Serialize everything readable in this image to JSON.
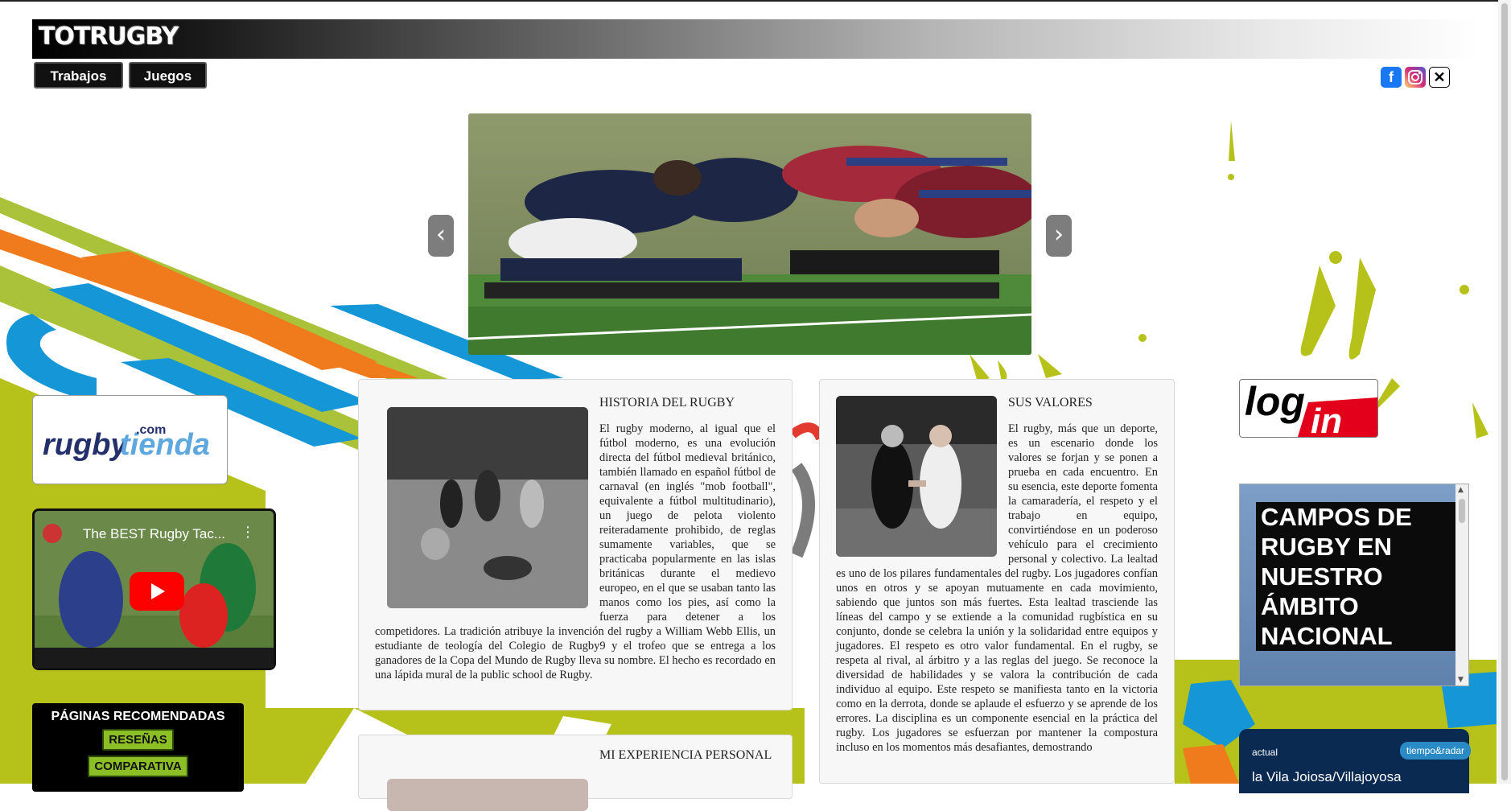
{
  "brand": {
    "logo_text": "TOTRUGBY"
  },
  "nav": [
    {
      "label": "Trabajos"
    },
    {
      "label": "Juegos"
    }
  ],
  "social": [
    {
      "icon": "facebook-icon",
      "color": "#1877f2"
    },
    {
      "icon": "instagram-icon",
      "color": "#d62976"
    },
    {
      "icon": "x-icon",
      "color": "#000000"
    }
  ],
  "carousel": {
    "prev": "‹",
    "next": "›",
    "image": "rugby-scrum-photo"
  },
  "articles": [
    {
      "title": "HISTORIA DEL RUGBY",
      "text": "El rugby moderno, al igual que el fútbol moderno, es una evolución directa del fútbol medieval británico, también llamado en español fútbol de carnaval (en inglés \"mob football\", equivalente a fútbol multitudinario), un juego de pelota violento reiteradamente prohibido, de reglas sumamente variables, que se practicaba popularmente en las islas británicas durante el medievo europeo, en el que se usaban tanto las manos como los pies, así como la fuerza para detener a los competidores. La tradición atribuye la invención del rugby a William Webb Ellis, un estudiante de teología del Colegio de Rugby9 y el trofeo que se entrega a los ganadores de la Copa del Mundo de Rugby lleva su nombre. El hecho es recordado en una lápida mural de la public school de Rugby."
    },
    {
      "title": "SUS VALORES",
      "text": "El rugby, más que un deporte, es un escenario donde los valores se forjan y se ponen a prueba en cada encuentro. En su esencia, este deporte fomenta la camaradería, el respeto y el trabajo en equipo, convirtiéndose en un poderoso vehículo para el crecimiento personal y colectivo. La lealtad es uno de los pilares fundamentales del rugby. Los jugadores confían unos en otros y se apoyan mutuamente en cada movimiento, sabiendo que juntos son más fuertes. Esta lealtad trasciende las líneas del campo y se extiende a la comunidad rugbística en su conjunto, donde se celebra la unión y la solidaridad entre equipos y jugadores. El respeto es otro valor fundamental. En el rugby, se respeta al rival, al árbitro y a las reglas del juego. Se reconoce la diversidad de habilidades y se valora la contribución de cada individuo al equipo. Este respeto se manifiesta tanto en la victoria como en la derrota, donde se aplaude el esfuerzo y se aprende de los errores. La disciplina es un componente esencial en la práctica del rugby. Los jugadores se esfuerzan por mantener la compostura incluso en los momentos más desafiantes, demostrando"
    },
    {
      "title": "MI EXPERIENCIA PERSONAL",
      "text": ""
    }
  ],
  "left": {
    "rugbytienda": {
      "main": "rugby",
      "accent": "tienda",
      "com": ".com"
    },
    "video": {
      "title": "The BEST Rugby Tac...",
      "menu": "⋮"
    },
    "recommended": {
      "title": "PÁGINAS RECOMENDADAS",
      "buttons": [
        "RESEÑAS",
        "COMPARATIVA"
      ]
    }
  },
  "right": {
    "login": {
      "line1": "log",
      "line2": "in"
    },
    "campos": {
      "title": "CAMPOS DE RUGBY EN NUESTRO ÁMBITO NACIONAL"
    },
    "weather": {
      "label": "actual",
      "brand": "tiempo&radar",
      "location": "la Vila Joiosa/Villajoyosa"
    }
  }
}
